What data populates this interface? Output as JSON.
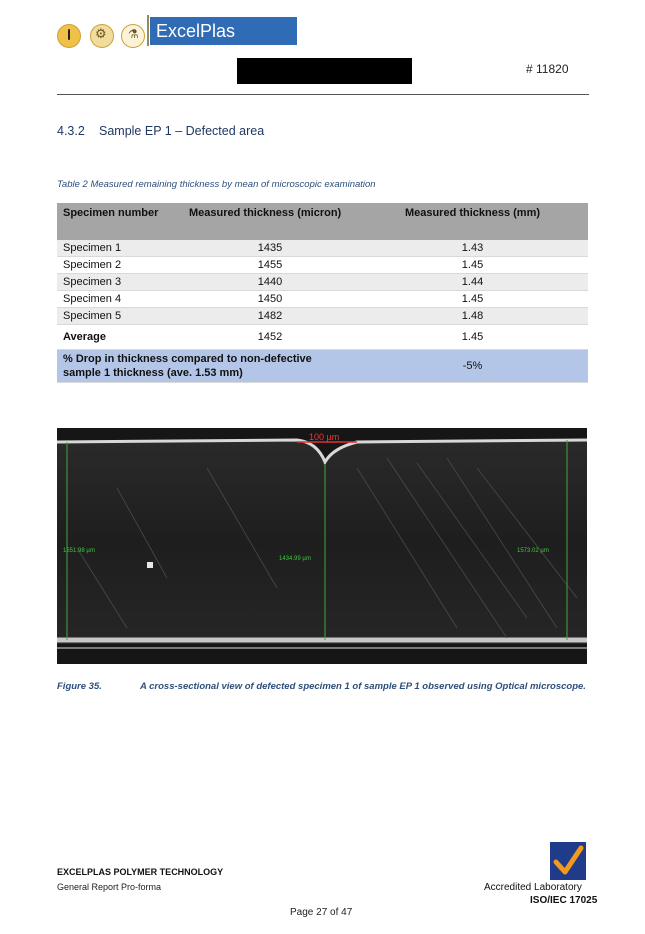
{
  "header": {
    "brand": "ExcelPlas",
    "doc_number": "# 11820"
  },
  "section": {
    "number": "4.3.2",
    "title": "Sample EP 1 – Defected area"
  },
  "table": {
    "caption": "Table 2 Measured remaining thickness by mean of microscopic examination",
    "columns": [
      "Specimen number",
      "Measured thickness (micron)",
      "Measured thickness (mm)"
    ],
    "rows": [
      [
        "Specimen 1",
        "1435",
        "1.43"
      ],
      [
        "Specimen 2",
        "1455",
        "1.45"
      ],
      [
        "Specimen 3",
        "1440",
        "1.44"
      ],
      [
        "Specimen 4",
        "1450",
        "1.45"
      ],
      [
        "Specimen 5",
        "1482",
        "1.48"
      ]
    ],
    "average": [
      "Average",
      "1452",
      "1.45"
    ],
    "drop_label": "% Drop in thickness compared to non-defective sample 1 thickness (ave. 1.53 mm)",
    "drop_value": "-5%"
  },
  "figure": {
    "scale_bar": "100 µm",
    "measure_left": "1551.98 µm",
    "measure_mid": "1434.99 µm",
    "measure_right": "1573.02 µm",
    "label": "Figure 35.",
    "caption": "A cross-sectional view of defected specimen 1 of sample EP 1 observed using Optical microscope."
  },
  "footer": {
    "company": "EXCELPLAS POLYMER TECHNOLOGY",
    "form": "General Report Pro-forma",
    "accreditation": "Accredited Laboratory",
    "standard": "ISO/IEC 17025",
    "page": "Page 27 of 47"
  }
}
